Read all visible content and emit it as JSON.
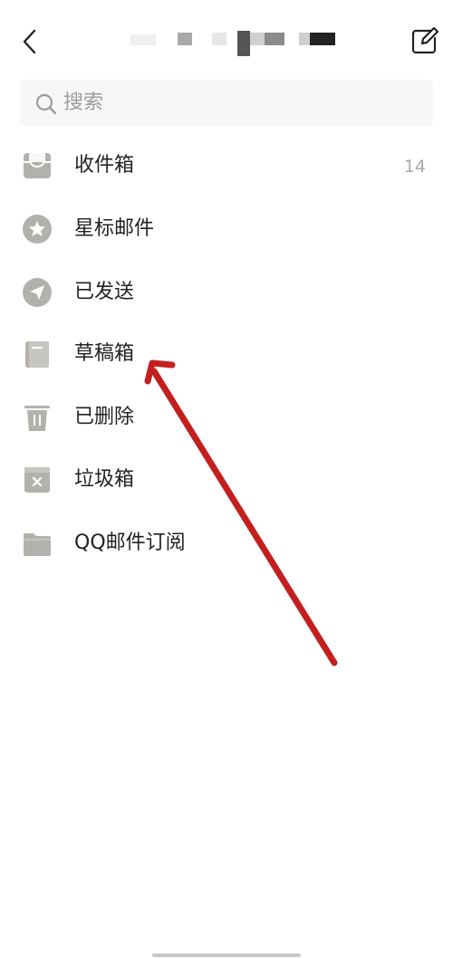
{
  "header": {
    "back_icon": "chevron-left-icon",
    "compose_icon": "compose-edit-icon",
    "title_obscured": true
  },
  "search": {
    "placeholder": "搜索",
    "icon": "search-icon"
  },
  "folders": [
    {
      "label": "收件箱",
      "count": "14",
      "icon": "inbox-icon"
    },
    {
      "label": "星标邮件",
      "icon": "star-icon"
    },
    {
      "label": "已发送",
      "icon": "send-icon"
    },
    {
      "label": "草稿箱",
      "icon": "draft-icon"
    },
    {
      "label": "已删除",
      "icon": "trash-icon"
    },
    {
      "label": "垃圾箱",
      "icon": "spam-box-icon"
    },
    {
      "label": "QQ邮件订阅",
      "icon": "folder-icon"
    }
  ],
  "colors": {
    "icon_gray": "#b3b1ae",
    "annotation_arrow": "#c41f1f",
    "search_bg": "#f7f7f5"
  }
}
